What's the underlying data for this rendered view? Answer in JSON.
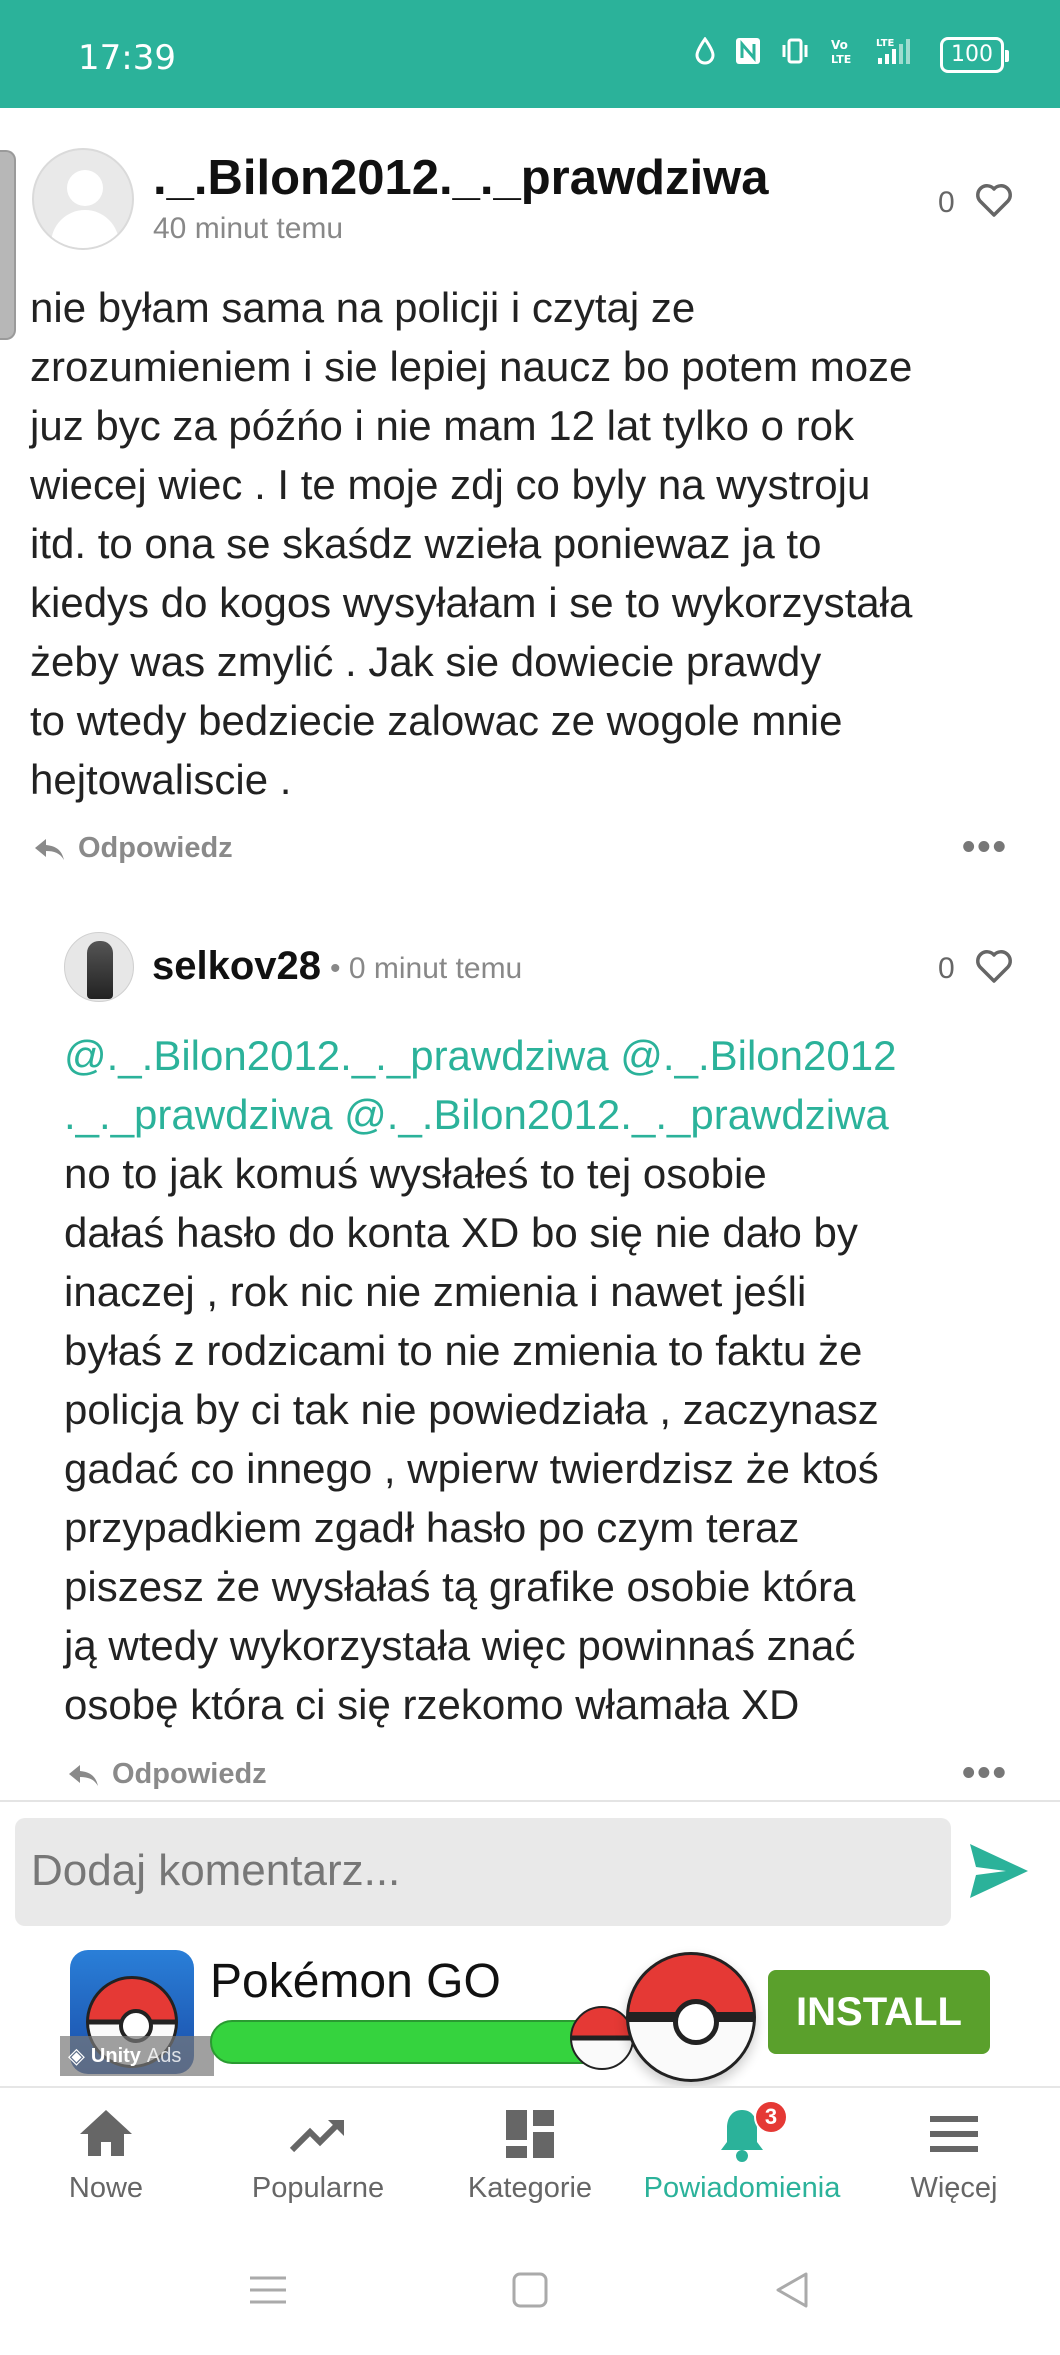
{
  "status_bar": {
    "time": "17:39",
    "battery": "100",
    "network_icons": [
      "water-drop-icon",
      "nfc-icon",
      "vibrate-icon",
      "volte-icon",
      "lte-signal-icon"
    ]
  },
  "comments": [
    {
      "username": "._.Bilon2012._._prawdziwa",
      "time": "40 minut temu",
      "likes": "0",
      "body": "nie byłam sama na policji i czytaj ze\nzrozumieniem i sie lepiej naucz bo potem moze\njuz byc za późńo i nie mam 12 lat tylko o rok\nwiecej wiec . I te moje zdj co byly na wystroju\nitd. to ona se skaśdz wzieła poniewaz ja to\nkiedys do kogos wysyłałam i se to wykorzystała\nżeby was zmylić . Jak sie dowiecie prawdy\nto wtedy bedziecie zalowac ze wogole mnie\nhejtowaliscie .",
      "reply_label": "Odpowiedz"
    },
    {
      "username": "selkov28",
      "time": "• 0 minut temu",
      "likes": "0",
      "mentions": "@._.Bilon2012._._prawdziwa @._.Bilon2012\n._._prawdziwa @._.Bilon2012._._prawdziwa",
      "body": "no to jak komuś wysłałeś to tej osobie\ndałaś hasło do konta XD bo się nie dało by\ninaczej , rok nic nie zmienia i nawet jeśli\nbyłaś z rodzicami to nie zmienia to faktu że\npolicja by ci tak nie powiedziała , zaczynasz\ngadać co innego , wpierw twierdzisz że ktoś\nprzypadkiem zgadł hasło po czym teraz\npiszesz że wysłałaś tą grafike osobie która\nją wtedy wykorzystała więc powinnaś znać\nosobę która ci się rzekomo włamała XD",
      "reply_label": "Odpowiedz"
    }
  ],
  "comment_input": {
    "placeholder": "Dodaj komentarz..."
  },
  "ad": {
    "title": "Pokémon GO",
    "install_label": "INSTALL",
    "unity_label": "Unity",
    "ads_label": "Ads"
  },
  "bottom_nav": {
    "items": [
      {
        "label": "Nowe",
        "icon": "home-icon"
      },
      {
        "label": "Popularne",
        "icon": "trending-icon"
      },
      {
        "label": "Kategorie",
        "icon": "categories-icon"
      },
      {
        "label": "Powiadomienia",
        "icon": "bell-icon",
        "badge": "3",
        "active": true
      },
      {
        "label": "Więcej",
        "icon": "menu-icon"
      }
    ]
  },
  "colors": {
    "accent": "#2bb29a",
    "badge": "#e53935",
    "install": "#5aa02c"
  }
}
